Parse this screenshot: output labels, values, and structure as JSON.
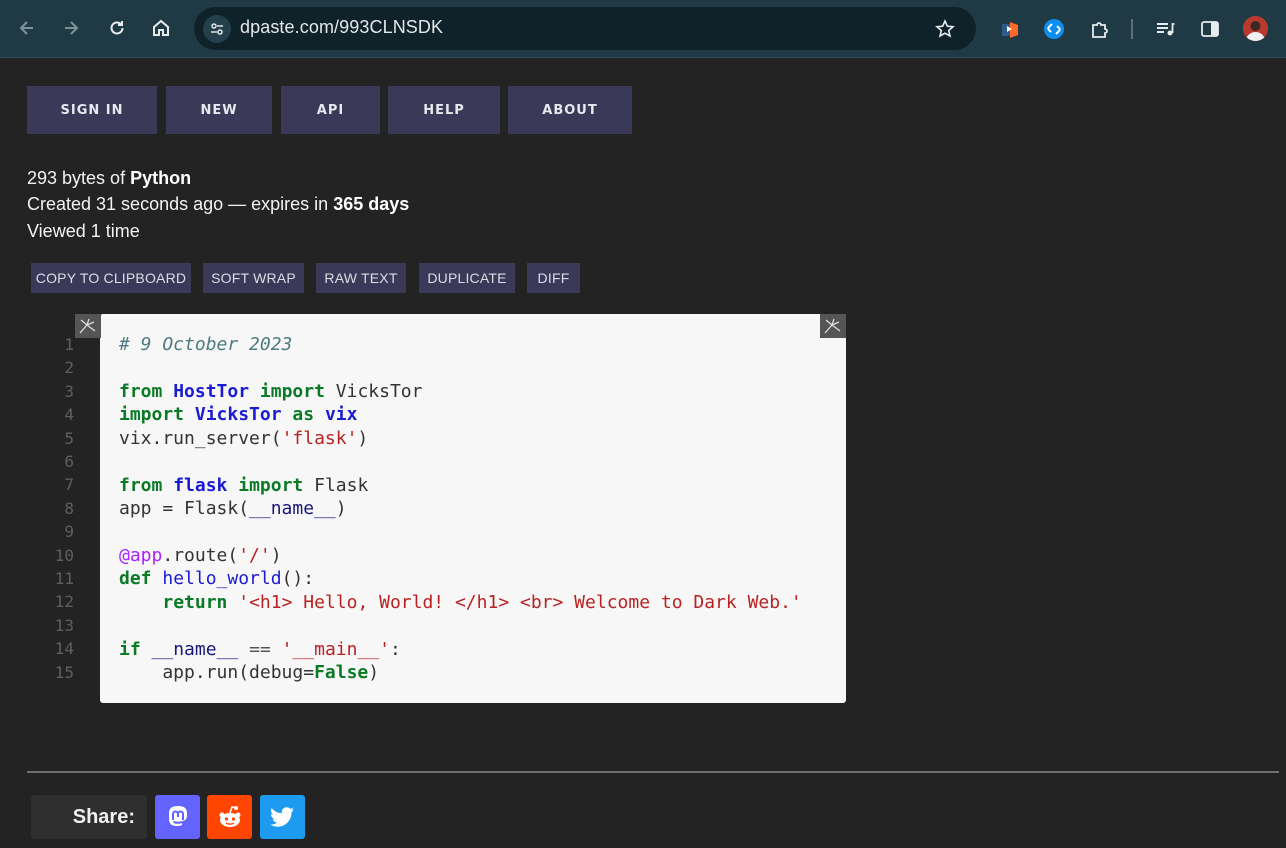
{
  "browser": {
    "url": "dpaste.com/993CLNSDK",
    "icons": [
      "back-icon",
      "forward-icon",
      "reload-icon",
      "home-icon",
      "site-settings-icon",
      "bookmark-star-icon",
      "extension-icon",
      "shazam-icon",
      "extensions-puzzle-icon",
      "media-queue-icon",
      "side-panel-icon",
      "avatar"
    ]
  },
  "nav": {
    "sign_in": "SIGN IN",
    "new": "NEW",
    "api": "API",
    "help": "HELP",
    "about": "ABOUT"
  },
  "meta": {
    "size_prefix": "293 bytes of ",
    "language": "Python",
    "created_prefix": "Created 31 seconds ago — expires in ",
    "expires": "365 days",
    "viewed": "Viewed 1 time"
  },
  "actions": {
    "copy": "COPY TO CLIPBOARD",
    "soft_wrap": "SOFT WRAP",
    "raw_text": "RAW TEXT",
    "duplicate": "DUPLICATE",
    "diff": "DIFF"
  },
  "code": {
    "line_numbers": [
      "1",
      "2",
      "3",
      "4",
      "5",
      "6",
      "7",
      "8",
      "9",
      "10",
      "11",
      "12",
      "13",
      "14",
      "15"
    ],
    "tokens": {
      "l1_comment": "# 9 October 2023",
      "l3_from": "from",
      "l3_mod": "HostTor",
      "l3_import": "import",
      "l3_name": " VicksTor",
      "l4_import": "import",
      "l4_mod": "VicksTor",
      "l4_as": "as",
      "l4_alias": "vix",
      "l5_call": "vix.run_server(",
      "l5_str": "'flask'",
      "l5_end": ")",
      "l7_from": "from",
      "l7_mod": "flask",
      "l7_import": "import",
      "l7_name": " Flask",
      "l8_a": "app = Flask(",
      "l8_b": "__name__",
      "l8_c": ")",
      "l10_deco": "@app",
      "l10_call": ".route(",
      "l10_str": "'/'",
      "l10_end": ")",
      "l11_def": "def",
      "l11_fn": "hello_world",
      "l11_end": "():",
      "l12_indent": "    ",
      "l12_return": "return",
      "l12_str": "'<h1> Hello, World! </h1> <br> Welcome to Dark Web.'",
      "l14_if": "if",
      "l14_name": "__name__",
      "l14_op": " == ",
      "l14_str": "'__main__'",
      "l14_end": ":",
      "l15_a": "    app.run(debug=",
      "l15_false": "False",
      "l15_end": ")"
    }
  },
  "share": {
    "label": "Share:",
    "mastodon_color": "#6364ff",
    "reddit_color": "#ff4500",
    "twitter_color": "#1d9bf0"
  }
}
